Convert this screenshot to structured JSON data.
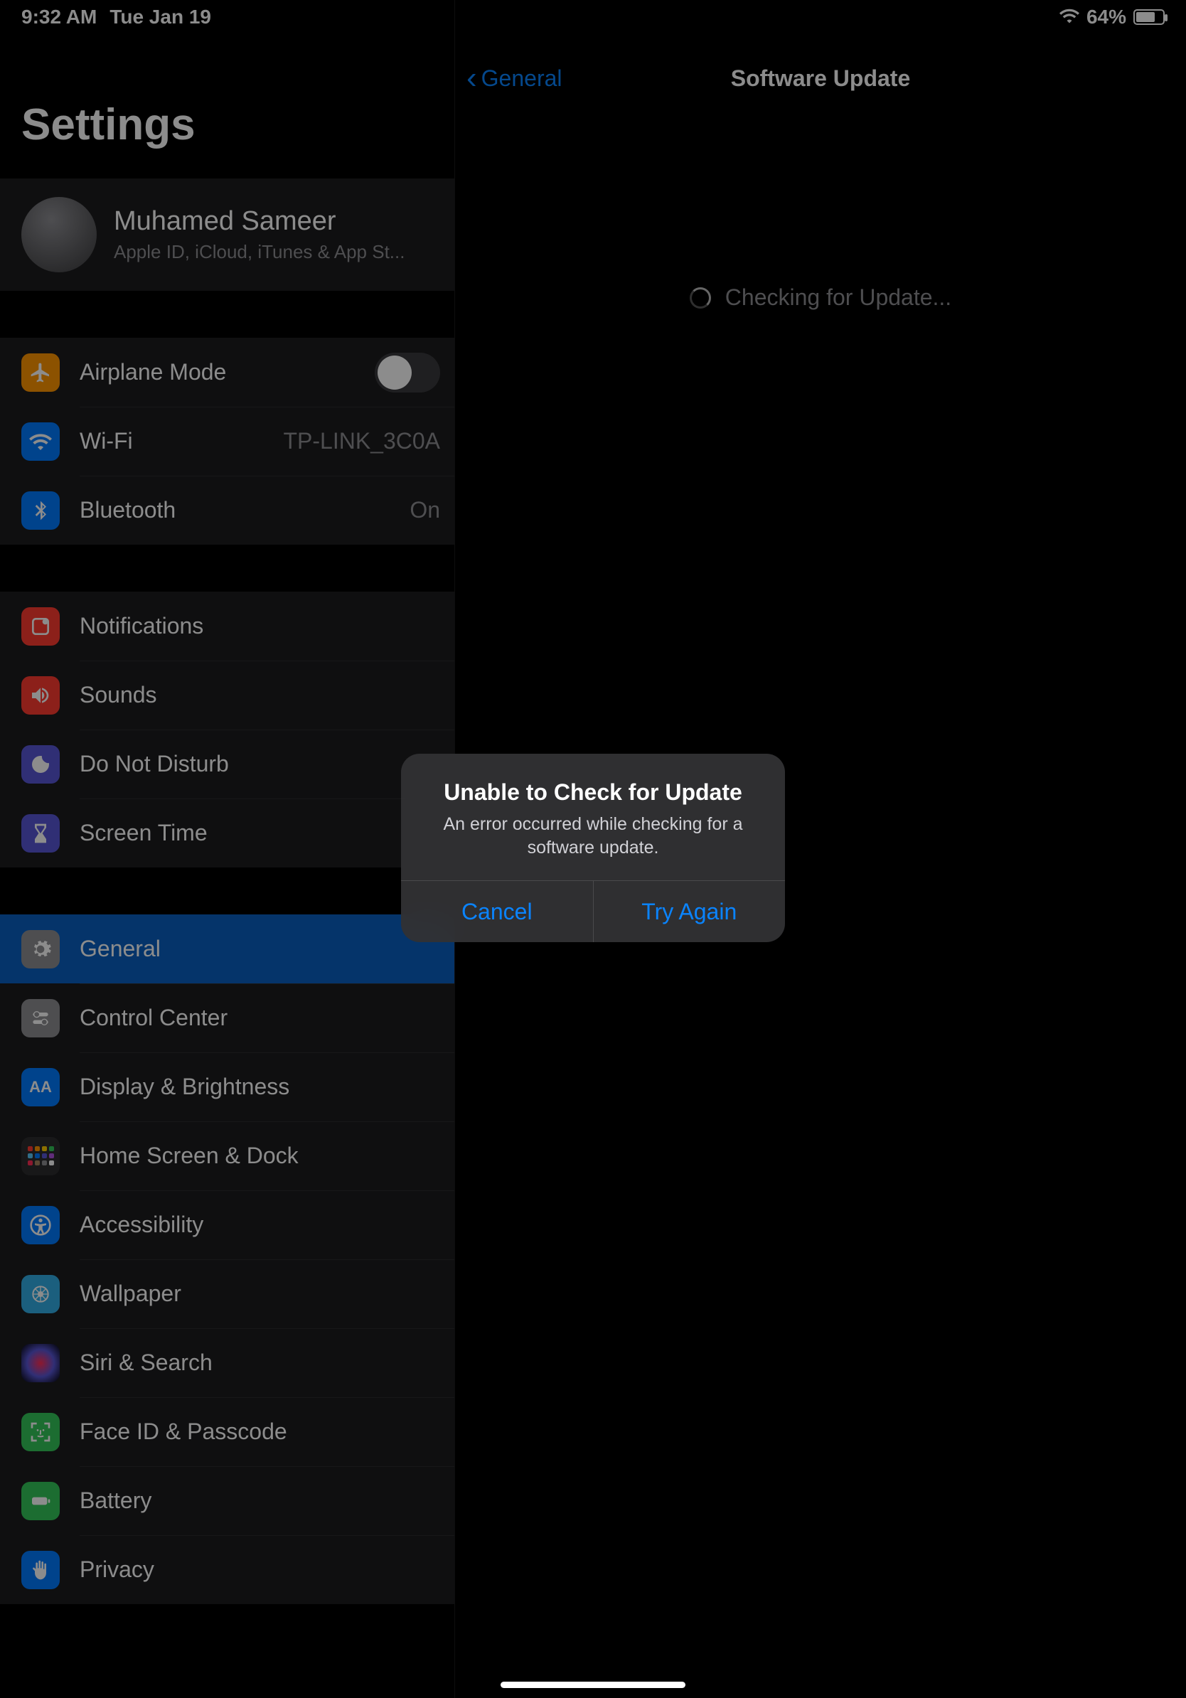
{
  "status": {
    "time": "9:32 AM",
    "date": "Tue Jan 19",
    "battery_pct": "64%"
  },
  "sidebar": {
    "title": "Settings",
    "profile": {
      "name": "Muhamed Sameer",
      "subtitle": "Apple ID, iCloud, iTunes & App St..."
    },
    "group1": {
      "airplane": "Airplane Mode",
      "wifi": "Wi-Fi",
      "wifi_value": "TP-LINK_3C0A",
      "bluetooth": "Bluetooth",
      "bluetooth_value": "On"
    },
    "group2": {
      "notifications": "Notifications",
      "sounds": "Sounds",
      "dnd": "Do Not Disturb",
      "screentime": "Screen Time"
    },
    "group3": {
      "general": "General",
      "control_center": "Control Center",
      "display": "Display & Brightness",
      "home_screen": "Home Screen & Dock",
      "accessibility": "Accessibility",
      "wallpaper": "Wallpaper",
      "siri": "Siri & Search",
      "faceid": "Face ID & Passcode",
      "battery": "Battery",
      "privacy": "Privacy"
    }
  },
  "detail": {
    "back": "General",
    "title": "Software Update",
    "status_text": "Checking for Update..."
  },
  "alert": {
    "title": "Unable to Check for Update",
    "message": "An error occurred while checking for a software update.",
    "cancel": "Cancel",
    "try_again": "Try Again"
  }
}
